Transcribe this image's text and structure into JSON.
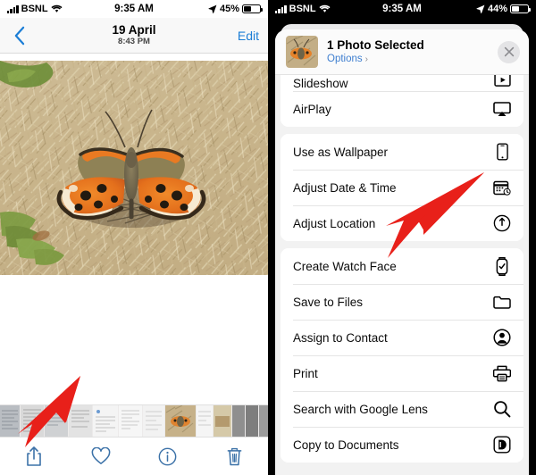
{
  "left_panel": {
    "status_bar": {
      "carrier": "BSNL",
      "wifi_icon": "wifi-icon",
      "signal_icon": "cellular-signal-icon",
      "time": "9:35 AM",
      "location_icon": "location-arrow-icon",
      "battery_percent": "45%",
      "battery_icon": "battery-icon"
    },
    "nav_bar": {
      "back_icon": "chevron-left-icon",
      "date": "19 April",
      "time": "8:43 PM",
      "edit_label": "Edit"
    },
    "photo": {
      "alt": "butterfly-on-dry-grass-photo"
    },
    "filmstrip": {
      "name": "photo-thumbnail-strip"
    },
    "toolbar": {
      "items": [
        {
          "name": "share-button",
          "icon": "share-icon"
        },
        {
          "name": "favorite-button",
          "icon": "heart-icon"
        },
        {
          "name": "info-button",
          "icon": "info-circle-icon"
        },
        {
          "name": "delete-button",
          "icon": "trash-icon"
        }
      ]
    },
    "annotation": {
      "arrow": "red-arrow-pointing-to-share-button"
    }
  },
  "right_panel": {
    "status_bar": {
      "carrier": "BSNL",
      "wifi_icon": "wifi-icon",
      "signal_icon": "cellular-signal-icon",
      "time": "9:35 AM",
      "location_icon": "location-arrow-icon",
      "battery_percent": "44%",
      "battery_icon": "battery-icon"
    },
    "share_sheet": {
      "title": "1 Photo Selected",
      "options_label": "Options",
      "options_chevron": "›",
      "close_icon": "close-x-icon",
      "thumbnail": "selected-photo-thumbnail",
      "groups": [
        {
          "name": "group-playback",
          "rows": [
            {
              "label": "Slideshow",
              "icon": "slideshow-play-icon",
              "clipped": true
            },
            {
              "label": "AirPlay",
              "icon": "airplay-icon",
              "clipped": false
            }
          ]
        },
        {
          "name": "group-photo-actions",
          "rows": [
            {
              "label": "Use as Wallpaper",
              "icon": "phone-wallpaper-icon",
              "clipped": false
            },
            {
              "label": "Adjust Date & Time",
              "icon": "calendar-clock-icon",
              "clipped": false
            },
            {
              "label": "Adjust Location",
              "icon": "location-pin-circle-icon",
              "clipped": false
            }
          ]
        },
        {
          "name": "group-export-actions",
          "rows": [
            {
              "label": "Create Watch Face",
              "icon": "apple-watch-icon",
              "clipped": false
            },
            {
              "label": "Save to Files",
              "icon": "folder-icon",
              "clipped": false
            },
            {
              "label": "Assign to Contact",
              "icon": "contact-person-icon",
              "clipped": false
            },
            {
              "label": "Print",
              "icon": "printer-icon",
              "clipped": false
            },
            {
              "label": "Search with Google Lens",
              "icon": "magnifier-search-icon",
              "clipped": false
            },
            {
              "label": "Copy to Documents",
              "icon": "documents-app-icon",
              "clipped": false
            }
          ]
        }
      ]
    },
    "annotation": {
      "arrow": "red-arrow-pointing-to-create-watch-face"
    }
  },
  "colors": {
    "accent_blue": "#1c7ed6",
    "link_blue": "#3f7fd0",
    "annotation_red": "#e8201a",
    "sheet_bg": "#f2f2f2",
    "row_bg": "#ffffff",
    "status_dark": "#000000"
  }
}
